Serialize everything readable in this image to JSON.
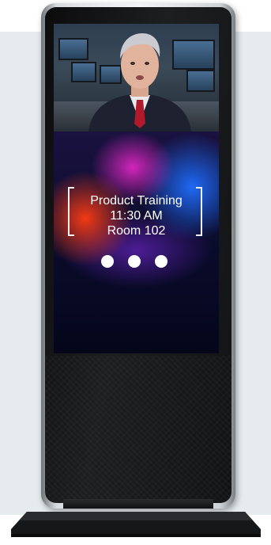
{
  "kiosk": {
    "video": {
      "icon": "news-presenter-video"
    },
    "promo": {
      "line1": "Product Training",
      "line2": "11:30 AM",
      "line3": "Room 102",
      "dots_icon": "three-dots-indicator",
      "bracket_color": "#f0f0f5"
    },
    "colors": {
      "frame": "#d9dcdf",
      "body": "#121314",
      "background_panel": "#e6ebee"
    }
  }
}
